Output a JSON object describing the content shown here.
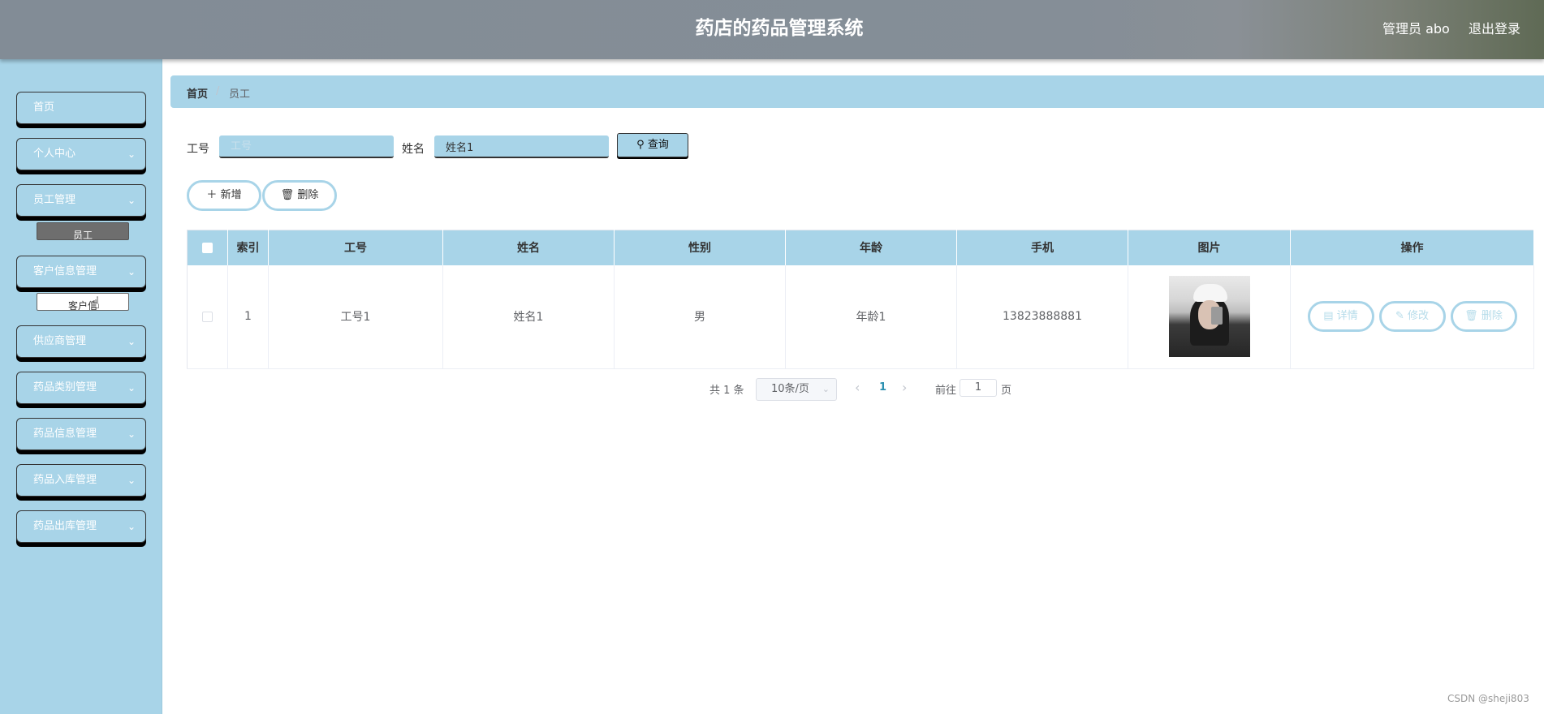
{
  "header": {
    "title": "药店的药品管理系统",
    "admin": "管理员 abo",
    "logout": "退出登录"
  },
  "sidebar": {
    "items": [
      {
        "label": "首页",
        "chevron": ""
      },
      {
        "label": "个人中心",
        "chevron": "⌄"
      },
      {
        "label": "员工管理",
        "chevron": "⌄"
      },
      {
        "label": "客户信息管理",
        "chevron": "⌄"
      },
      {
        "label": "供应商管理",
        "chevron": "⌄"
      },
      {
        "label": "药品类别管理",
        "chevron": "⌄"
      },
      {
        "label": "药品信息管理",
        "chevron": "⌄"
      },
      {
        "label": "药品入库管理",
        "chevron": "⌄"
      },
      {
        "label": "药品出库管理",
        "chevron": "⌄"
      }
    ],
    "sub_employee": "员工",
    "sub_customer": "客户信"
  },
  "breadcrumb": {
    "home": "首页",
    "separator": "/",
    "current": "员工"
  },
  "search": {
    "id_label": "工号",
    "id_placeholder": "工号",
    "id_value": "",
    "name_label": "姓名",
    "name_value": "姓名1",
    "query_icon": "search-icon",
    "query_label": "查询"
  },
  "actions": {
    "add_icon": "plus-icon",
    "add_label": "新增",
    "delete_icon": "trash-icon",
    "delete_label": "删除"
  },
  "table": {
    "headers": [
      "索引",
      "工号",
      "姓名",
      "性别",
      "年龄",
      "手机",
      "图片",
      "操作"
    ],
    "rows": [
      {
        "index": "1",
        "id": "工号1",
        "name": "姓名1",
        "gender": "男",
        "age": "年龄1",
        "phone": "13823888881"
      }
    ],
    "row_actions": {
      "detail": "详情",
      "edit": "修改",
      "delete": "删除"
    }
  },
  "pagination": {
    "total": "共 1 条",
    "page_size": "10条/页",
    "prev": "‹",
    "current_page": "1",
    "next": "›",
    "goto_label": "前往",
    "goto_value": "1",
    "goto_suffix": "页"
  },
  "watermark": "CSDN @sheji803",
  "colors": {
    "accent": "#a8d4e8",
    "header": "#858e97"
  }
}
